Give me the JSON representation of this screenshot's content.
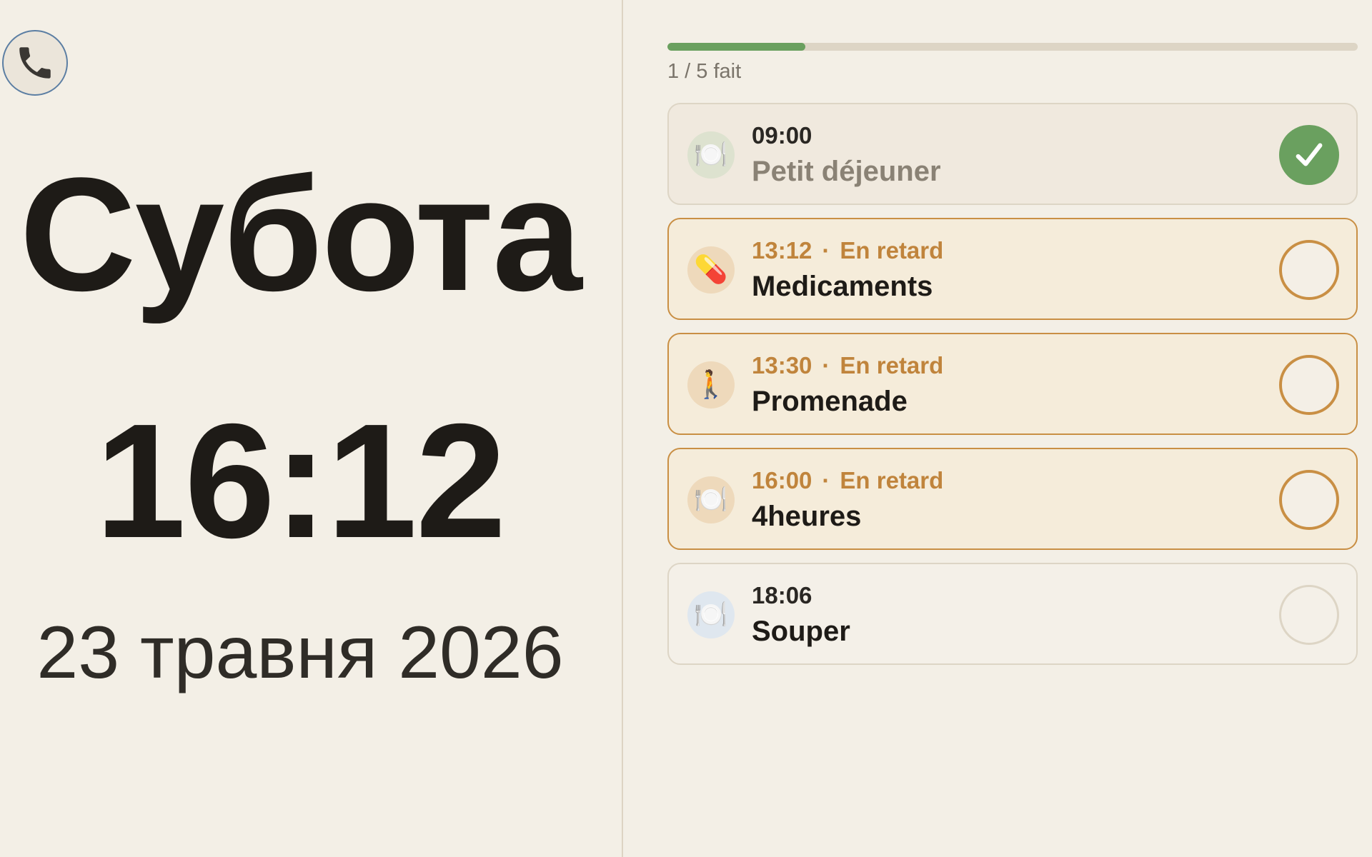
{
  "header": {
    "call_icon": "phone-icon",
    "weekday": "Субота",
    "time": "16:12",
    "date": "23 травня 2026"
  },
  "progress": {
    "done": 1,
    "total": 5,
    "fraction": 0.2,
    "label": "1 / 5 fait",
    "fill_color": "#6aa05f"
  },
  "tasks": [
    {
      "time": "09:00",
      "status_label": "",
      "title": "Petit déjeuner",
      "state": "done",
      "icon": "plate-icon",
      "icon_glyph": "🍽️"
    },
    {
      "time": "13:12",
      "status_label": "En retard",
      "title": "Medicaments",
      "state": "late",
      "icon": "pill-icon",
      "icon_glyph": "💊"
    },
    {
      "time": "13:30",
      "status_label": "En retard",
      "title": "Promenade",
      "state": "late",
      "icon": "walking-icon",
      "icon_glyph": "🚶"
    },
    {
      "time": "16:00",
      "status_label": "En retard",
      "title": "4heures",
      "state": "late",
      "icon": "plate-icon",
      "icon_glyph": "🍽️"
    },
    {
      "time": "18:06",
      "status_label": "",
      "title": "Souper",
      "state": "upcoming",
      "icon": "plate-icon",
      "icon_glyph": "🍽️"
    }
  ],
  "colors": {
    "background": "#f3efe6",
    "done": "#6aa05f",
    "late": "#c98f44",
    "text": "#1e1b17"
  }
}
